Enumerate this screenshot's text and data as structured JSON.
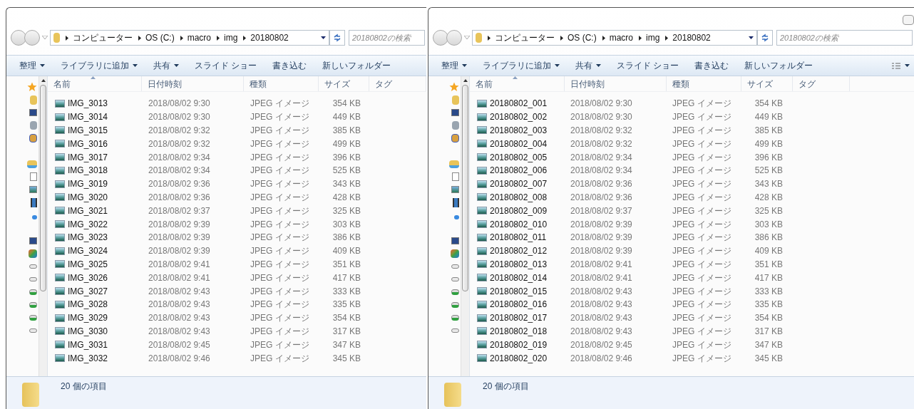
{
  "windows": [
    {
      "address": {
        "crumbs": [
          "コンピューター",
          "OS (C:)",
          "macro",
          "img",
          "20180802"
        ]
      },
      "search": {
        "placeholder": "20180802の検索"
      },
      "toolbar": [
        {
          "label": "整理",
          "menu": true
        },
        {
          "label": "ライブラリに追加",
          "menu": true
        },
        {
          "label": "共有",
          "menu": true
        },
        {
          "label": "スライド ショー",
          "menu": false
        },
        {
          "label": "書き込む",
          "menu": false
        },
        {
          "label": "新しいフォルダー",
          "menu": false
        }
      ],
      "columns": [
        {
          "label": "名前",
          "sorted": true
        },
        {
          "label": "日付時刻",
          "sorted": false
        },
        {
          "label": "種類",
          "sorted": false
        },
        {
          "label": "サイズ",
          "sorted": false
        },
        {
          "label": "タグ",
          "sorted": false
        }
      ],
      "files": [
        {
          "name": "IMG_3013",
          "date": "2018/08/02 9:30",
          "type": "JPEG イメージ",
          "size": "354 KB"
        },
        {
          "name": "IMG_3014",
          "date": "2018/08/02 9:30",
          "type": "JPEG イメージ",
          "size": "449 KB"
        },
        {
          "name": "IMG_3015",
          "date": "2018/08/02 9:32",
          "type": "JPEG イメージ",
          "size": "385 KB"
        },
        {
          "name": "IMG_3016",
          "date": "2018/08/02 9:32",
          "type": "JPEG イメージ",
          "size": "499 KB"
        },
        {
          "name": "IMG_3017",
          "date": "2018/08/02 9:34",
          "type": "JPEG イメージ",
          "size": "396 KB"
        },
        {
          "name": "IMG_3018",
          "date": "2018/08/02 9:34",
          "type": "JPEG イメージ",
          "size": "525 KB"
        },
        {
          "name": "IMG_3019",
          "date": "2018/08/02 9:36",
          "type": "JPEG イメージ",
          "size": "343 KB"
        },
        {
          "name": "IMG_3020",
          "date": "2018/08/02 9:36",
          "type": "JPEG イメージ",
          "size": "428 KB"
        },
        {
          "name": "IMG_3021",
          "date": "2018/08/02 9:37",
          "type": "JPEG イメージ",
          "size": "325 KB"
        },
        {
          "name": "IMG_3022",
          "date": "2018/08/02 9:39",
          "type": "JPEG イメージ",
          "size": "303 KB"
        },
        {
          "name": "IMG_3023",
          "date": "2018/08/02 9:39",
          "type": "JPEG イメージ",
          "size": "386 KB"
        },
        {
          "name": "IMG_3024",
          "date": "2018/08/02 9:39",
          "type": "JPEG イメージ",
          "size": "409 KB"
        },
        {
          "name": "IMG_3025",
          "date": "2018/08/02 9:41",
          "type": "JPEG イメージ",
          "size": "351 KB"
        },
        {
          "name": "IMG_3026",
          "date": "2018/08/02 9:41",
          "type": "JPEG イメージ",
          "size": "417 KB"
        },
        {
          "name": "IMG_3027",
          "date": "2018/08/02 9:43",
          "type": "JPEG イメージ",
          "size": "333 KB"
        },
        {
          "name": "IMG_3028",
          "date": "2018/08/02 9:43",
          "type": "JPEG イメージ",
          "size": "335 KB"
        },
        {
          "name": "IMG_3029",
          "date": "2018/08/02 9:43",
          "type": "JPEG イメージ",
          "size": "354 KB"
        },
        {
          "name": "IMG_3030",
          "date": "2018/08/02 9:43",
          "type": "JPEG イメージ",
          "size": "317 KB"
        },
        {
          "name": "IMG_3031",
          "date": "2018/08/02 9:45",
          "type": "JPEG イメージ",
          "size": "347 KB"
        },
        {
          "name": "IMG_3032",
          "date": "2018/08/02 9:46",
          "type": "JPEG イメージ",
          "size": "345 KB"
        }
      ],
      "status": "20 個の項目"
    },
    {
      "address": {
        "crumbs": [
          "コンピューター",
          "OS (C:)",
          "macro",
          "img",
          "20180802"
        ]
      },
      "search": {
        "placeholder": "20180802の検索"
      },
      "toolbar": [
        {
          "label": "整理",
          "menu": true
        },
        {
          "label": "ライブラリに追加",
          "menu": true
        },
        {
          "label": "共有",
          "menu": true
        },
        {
          "label": "スライド ショー",
          "menu": false
        },
        {
          "label": "書き込む",
          "menu": false
        },
        {
          "label": "新しいフォルダー",
          "menu": false
        }
      ],
      "columns": [
        {
          "label": "名前",
          "sorted": true
        },
        {
          "label": "日付時刻",
          "sorted": false
        },
        {
          "label": "種類",
          "sorted": false
        },
        {
          "label": "サイズ",
          "sorted": false
        },
        {
          "label": "タグ",
          "sorted": false
        }
      ],
      "files": [
        {
          "name": "20180802_001",
          "date": "2018/08/02 9:30",
          "type": "JPEG イメージ",
          "size": "354 KB"
        },
        {
          "name": "20180802_002",
          "date": "2018/08/02 9:30",
          "type": "JPEG イメージ",
          "size": "449 KB"
        },
        {
          "name": "20180802_003",
          "date": "2018/08/02 9:32",
          "type": "JPEG イメージ",
          "size": "385 KB"
        },
        {
          "name": "20180802_004",
          "date": "2018/08/02 9:32",
          "type": "JPEG イメージ",
          "size": "499 KB"
        },
        {
          "name": "20180802_005",
          "date": "2018/08/02 9:34",
          "type": "JPEG イメージ",
          "size": "396 KB"
        },
        {
          "name": "20180802_006",
          "date": "2018/08/02 9:34",
          "type": "JPEG イメージ",
          "size": "525 KB"
        },
        {
          "name": "20180802_007",
          "date": "2018/08/02 9:36",
          "type": "JPEG イメージ",
          "size": "343 KB"
        },
        {
          "name": "20180802_008",
          "date": "2018/08/02 9:36",
          "type": "JPEG イメージ",
          "size": "428 KB"
        },
        {
          "name": "20180802_009",
          "date": "2018/08/02 9:37",
          "type": "JPEG イメージ",
          "size": "325 KB"
        },
        {
          "name": "20180802_010",
          "date": "2018/08/02 9:39",
          "type": "JPEG イメージ",
          "size": "303 KB"
        },
        {
          "name": "20180802_011",
          "date": "2018/08/02 9:39",
          "type": "JPEG イメージ",
          "size": "386 KB"
        },
        {
          "name": "20180802_012",
          "date": "2018/08/02 9:39",
          "type": "JPEG イメージ",
          "size": "409 KB"
        },
        {
          "name": "20180802_013",
          "date": "2018/08/02 9:41",
          "type": "JPEG イメージ",
          "size": "351 KB"
        },
        {
          "name": "20180802_014",
          "date": "2018/08/02 9:41",
          "type": "JPEG イメージ",
          "size": "417 KB"
        },
        {
          "name": "20180802_015",
          "date": "2018/08/02 9:43",
          "type": "JPEG イメージ",
          "size": "333 KB"
        },
        {
          "name": "20180802_016",
          "date": "2018/08/02 9:43",
          "type": "JPEG イメージ",
          "size": "335 KB"
        },
        {
          "name": "20180802_017",
          "date": "2018/08/02 9:43",
          "type": "JPEG イメージ",
          "size": "354 KB"
        },
        {
          "name": "20180802_018",
          "date": "2018/08/02 9:43",
          "type": "JPEG イメージ",
          "size": "317 KB"
        },
        {
          "name": "20180802_019",
          "date": "2018/08/02 9:45",
          "type": "JPEG イメージ",
          "size": "347 KB"
        },
        {
          "name": "20180802_020",
          "date": "2018/08/02 9:46",
          "type": "JPEG イメージ",
          "size": "345 KB"
        }
      ],
      "status": "20 個の項目"
    }
  ]
}
